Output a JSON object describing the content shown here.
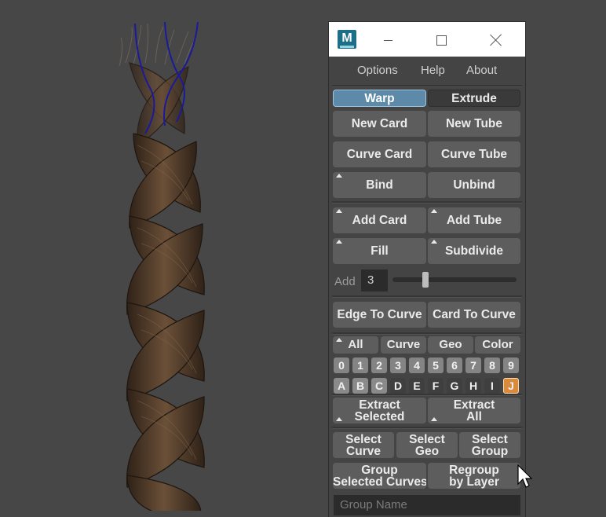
{
  "window": {
    "logo_letter": "M"
  },
  "menu": {
    "options": "Options",
    "help": "Help",
    "about": "About"
  },
  "mode": {
    "warp": "Warp",
    "extrude": "Extrude",
    "selected": "Warp"
  },
  "create": {
    "new_card": "New Card",
    "new_tube": "New Tube",
    "curve_card": "Curve Card",
    "curve_tube": "Curve Tube",
    "bind": "Bind",
    "unbind": "Unbind"
  },
  "add": {
    "add_card": "Add Card",
    "add_tube": "Add Tube",
    "fill": "Fill",
    "subdivide": "Subdivide",
    "label": "Add",
    "value": "3",
    "slider_fraction": 0.25
  },
  "convert": {
    "edge_to_curve": "Edge To Curve",
    "card_to_curve": "Card To Curve"
  },
  "filters": {
    "all": "All",
    "curve": "Curve",
    "geo": "Geo",
    "color": "Color"
  },
  "layers": {
    "numbers": [
      "0",
      "1",
      "2",
      "3",
      "4",
      "5",
      "6",
      "7",
      "8",
      "9"
    ],
    "letters": [
      "A",
      "B",
      "C",
      "D",
      "E",
      "F",
      "G",
      "H",
      "I",
      "J"
    ],
    "active_letter": "J"
  },
  "extract": {
    "selected_line1": "Extract",
    "selected_line2": "Selected",
    "all_line1": "Extract",
    "all_line2": "All"
  },
  "select": {
    "curve_line1": "Select",
    "curve_line2": "Curve",
    "geo_line1": "Select",
    "geo_line2": "Geo",
    "group_line1": "Select",
    "group_line2": "Group"
  },
  "group": {
    "group_line1": "Group",
    "group_line2": "Selected Curves",
    "regroup_line1": "Regroup",
    "regroup_line2": "by Layer",
    "name_placeholder": "Group Name"
  },
  "colors": {
    "viewport_bg": "#474747",
    "warp_active": "#5c8aa8",
    "layer_active": "#d88b3d",
    "braid_brown": "#5a4330",
    "curve_blue": "#1a1a9a"
  }
}
